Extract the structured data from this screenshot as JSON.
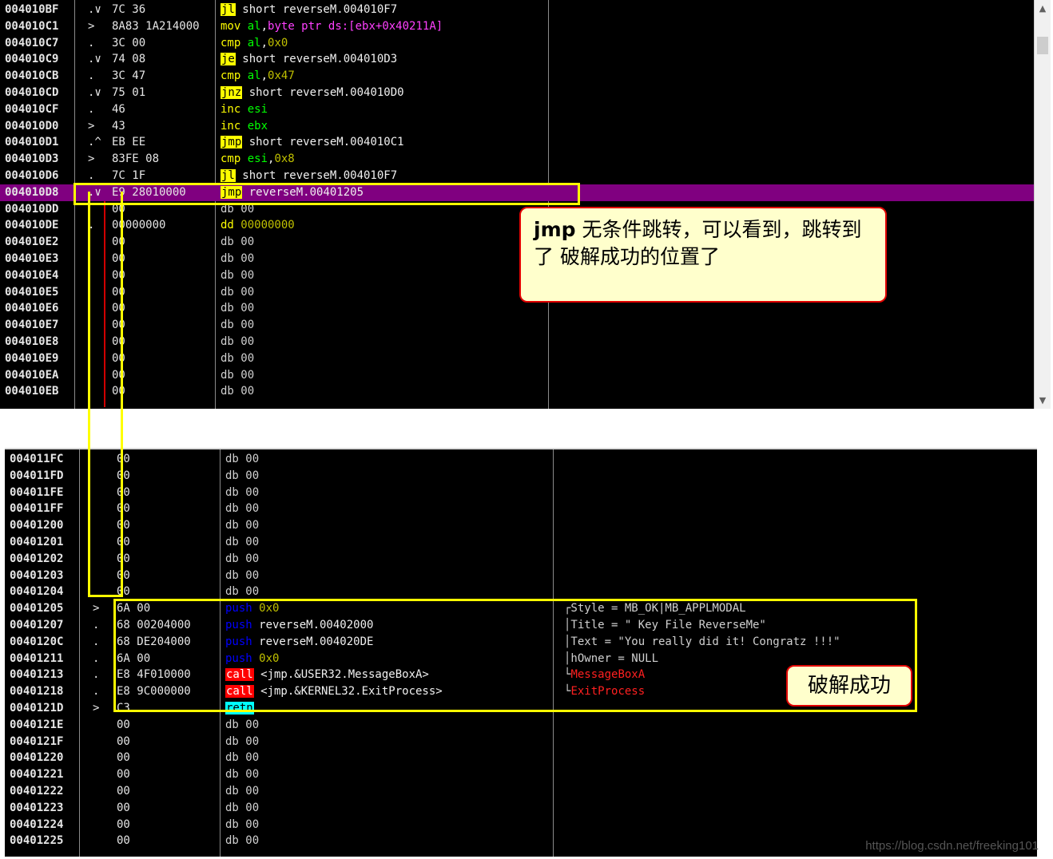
{
  "top_rows": [
    {
      "addr": "004010BF",
      "arrow": ".∨",
      "hex": "7C 36",
      "mn": "jl",
      "mnStyle": "y",
      "args": [
        {
          "t": " short reverseM.004010F7",
          "c": "white"
        }
      ]
    },
    {
      "addr": "004010C1",
      "arrow": ">",
      "hex": "8A83 1A214000",
      "mn": "mov",
      "mnStyle": "g",
      "args": [
        {
          "t": " al",
          "c": "reg"
        },
        {
          "t": ",",
          "c": "white"
        },
        {
          "t": "byte ptr ds:[ebx+0x40211A]",
          "c": "mag"
        }
      ]
    },
    {
      "addr": "004010C7",
      "arrow": ".",
      "hex": "3C 00",
      "mn": "cmp",
      "mnStyle": "g",
      "args": [
        {
          "t": " al",
          "c": "reg"
        },
        {
          "t": ",",
          "c": "white"
        },
        {
          "t": "0x0",
          "c": "num"
        }
      ]
    },
    {
      "addr": "004010C9",
      "arrow": ".∨",
      "hex": "74 08",
      "mn": "je",
      "mnStyle": "y",
      "args": [
        {
          "t": " short reverseM.004010D3",
          "c": "white"
        }
      ]
    },
    {
      "addr": "004010CB",
      "arrow": ".",
      "hex": "3C 47",
      "mn": "cmp",
      "mnStyle": "g",
      "args": [
        {
          "t": " al",
          "c": "reg"
        },
        {
          "t": ",",
          "c": "white"
        },
        {
          "t": "0x47",
          "c": "num"
        }
      ]
    },
    {
      "addr": "004010CD",
      "arrow": ".∨",
      "hex": "75 01",
      "mn": "jnz",
      "mnStyle": "y",
      "args": [
        {
          "t": " short reverseM.004010D0",
          "c": "white"
        }
      ]
    },
    {
      "addr": "004010CF",
      "arrow": ".",
      "hex": "46",
      "mn": "inc",
      "mnStyle": "g",
      "args": [
        {
          "t": " esi",
          "c": "reg"
        }
      ]
    },
    {
      "addr": "004010D0",
      "arrow": ">",
      "hex": "43",
      "mn": "inc",
      "mnStyle": "g",
      "args": [
        {
          "t": " ebx",
          "c": "reg"
        }
      ]
    },
    {
      "addr": "004010D1",
      "arrow": ".^",
      "hex": "EB EE",
      "mn": "jmp",
      "mnStyle": "y",
      "args": [
        {
          "t": " short reverseM.004010C1",
          "c": "white"
        }
      ]
    },
    {
      "addr": "004010D3",
      "arrow": ">",
      "hex": "83FE 08",
      "mn": "cmp",
      "mnStyle": "g",
      "args": [
        {
          "t": " esi",
          "c": "reg"
        },
        {
          "t": ",",
          "c": "white"
        },
        {
          "t": "0x8",
          "c": "num"
        }
      ]
    },
    {
      "addr": "004010D6",
      "arrow": ".",
      "hex": "7C 1F",
      "mn": "jl",
      "mnStyle": "y",
      "args": [
        {
          "t": " short reverseM.004010F7",
          "c": "white"
        }
      ]
    },
    {
      "addr": "004010D8",
      "arrow": ".∨",
      "hex": "E9 28010000",
      "mn": "jmp",
      "mnStyle": "y",
      "args": [
        {
          "t": " reverseM.00401205",
          "c": "white"
        }
      ],
      "highlight": true
    },
    {
      "addr": "004010DD",
      "arrow": "",
      "hex": "00",
      "mn": "db",
      "mnStyle": "d",
      "args": [
        {
          "t": " 00",
          "c": "cm"
        }
      ]
    },
    {
      "addr": "004010DE",
      "arrow": ".",
      "hex": "00000000",
      "mn": "dd",
      "mnStyle": "dd",
      "args": [
        {
          "t": " 00000000",
          "c": "num"
        }
      ]
    },
    {
      "addr": "004010E2",
      "arrow": "",
      "hex": "00",
      "mn": "db",
      "mnStyle": "d",
      "args": [
        {
          "t": " 00",
          "c": "cm"
        }
      ]
    },
    {
      "addr": "004010E3",
      "arrow": "",
      "hex": "00",
      "mn": "db",
      "mnStyle": "d",
      "args": [
        {
          "t": " 00",
          "c": "cm"
        }
      ]
    },
    {
      "addr": "004010E4",
      "arrow": "",
      "hex": "00",
      "mn": "db",
      "mnStyle": "d",
      "args": [
        {
          "t": " 00",
          "c": "cm"
        }
      ]
    },
    {
      "addr": "004010E5",
      "arrow": "",
      "hex": "00",
      "mn": "db",
      "mnStyle": "d",
      "args": [
        {
          "t": " 00",
          "c": "cm"
        }
      ]
    },
    {
      "addr": "004010E6",
      "arrow": "",
      "hex": "00",
      "mn": "db",
      "mnStyle": "d",
      "args": [
        {
          "t": " 00",
          "c": "cm"
        }
      ]
    },
    {
      "addr": "004010E7",
      "arrow": "",
      "hex": "00",
      "mn": "db",
      "mnStyle": "d",
      "args": [
        {
          "t": " 00",
          "c": "cm"
        }
      ]
    },
    {
      "addr": "004010E8",
      "arrow": "",
      "hex": "00",
      "mn": "db",
      "mnStyle": "d",
      "args": [
        {
          "t": " 00",
          "c": "cm"
        }
      ]
    },
    {
      "addr": "004010E9",
      "arrow": "",
      "hex": "00",
      "mn": "db",
      "mnStyle": "d",
      "args": [
        {
          "t": " 00",
          "c": "cm"
        }
      ]
    },
    {
      "addr": "004010EA",
      "arrow": "",
      "hex": "00",
      "mn": "db",
      "mnStyle": "d",
      "args": [
        {
          "t": " 00",
          "c": "cm"
        }
      ]
    },
    {
      "addr": "004010EB",
      "arrow": "",
      "hex": "00",
      "mn": "db",
      "mnStyle": "d",
      "args": [
        {
          "t": " 00",
          "c": "cm"
        }
      ]
    }
  ],
  "bottom_rows": [
    {
      "addr": "004011FC",
      "arrow": "",
      "hex": "00",
      "mn": "db",
      "mnStyle": "d",
      "args": [
        {
          "t": " 00",
          "c": "cm"
        }
      ]
    },
    {
      "addr": "004011FD",
      "arrow": "",
      "hex": "00",
      "mn": "db",
      "mnStyle": "d",
      "args": [
        {
          "t": " 00",
          "c": "cm"
        }
      ]
    },
    {
      "addr": "004011FE",
      "arrow": "",
      "hex": "00",
      "mn": "db",
      "mnStyle": "d",
      "args": [
        {
          "t": " 00",
          "c": "cm"
        }
      ]
    },
    {
      "addr": "004011FF",
      "arrow": "",
      "hex": "00",
      "mn": "db",
      "mnStyle": "d",
      "args": [
        {
          "t": " 00",
          "c": "cm"
        }
      ]
    },
    {
      "addr": "00401200",
      "arrow": "",
      "hex": "00",
      "mn": "db",
      "mnStyle": "d",
      "args": [
        {
          "t": " 00",
          "c": "cm"
        }
      ]
    },
    {
      "addr": "00401201",
      "arrow": "",
      "hex": "00",
      "mn": "db",
      "mnStyle": "d",
      "args": [
        {
          "t": " 00",
          "c": "cm"
        }
      ]
    },
    {
      "addr": "00401202",
      "arrow": "",
      "hex": "00",
      "mn": "db",
      "mnStyle": "d",
      "args": [
        {
          "t": " 00",
          "c": "cm"
        }
      ]
    },
    {
      "addr": "00401203",
      "arrow": "",
      "hex": "00",
      "mn": "db",
      "mnStyle": "d",
      "args": [
        {
          "t": " 00",
          "c": "cm"
        }
      ]
    },
    {
      "addr": "00401204",
      "arrow": "",
      "hex": "00",
      "mn": "db",
      "mnStyle": "d",
      "args": [
        {
          "t": " 00",
          "c": "cm"
        }
      ]
    },
    {
      "addr": "00401205",
      "arrow": ">",
      "hex": "6A 00",
      "mn": "push",
      "mnStyle": "p",
      "args": [
        {
          "t": " 0x0",
          "c": "num"
        }
      ],
      "comment": [
        {
          "t": "┌Style = MB_OK|MB_APPLMODAL",
          "c": "cm"
        }
      ]
    },
    {
      "addr": "00401207",
      "arrow": ".",
      "hex": "68 00204000",
      "mn": "push",
      "mnStyle": "p",
      "args": [
        {
          "t": " reverseM.00402000",
          "c": "white"
        }
      ],
      "comment": [
        {
          "t": "│Title = \" Key File ReverseMe\"",
          "c": "cm"
        }
      ]
    },
    {
      "addr": "0040120C",
      "arrow": ".",
      "hex": "68 DE204000",
      "mn": "push",
      "mnStyle": "p",
      "args": [
        {
          "t": " reverseM.004020DE",
          "c": "white"
        }
      ],
      "comment": [
        {
          "t": "│Text = \"You really did it! Congratz !!!\"",
          "c": "cm"
        }
      ]
    },
    {
      "addr": "00401211",
      "arrow": ".",
      "hex": "6A 00",
      "mn": "push",
      "mnStyle": "p",
      "args": [
        {
          "t": " 0x0",
          "c": "num"
        }
      ],
      "comment": [
        {
          "t": "│hOwner = NULL",
          "c": "cm"
        }
      ]
    },
    {
      "addr": "00401213",
      "arrow": ".",
      "hex": "E8 4F010000",
      "mn": "call",
      "mnStyle": "r",
      "args": [
        {
          "t": " <jmp.&USER32.MessageBoxA>",
          "c": "white"
        }
      ],
      "comment": [
        {
          "t": "└",
          "c": "cm"
        },
        {
          "t": "MessageBoxA",
          "c": "cm-red"
        }
      ]
    },
    {
      "addr": "00401218",
      "arrow": ".",
      "hex": "E8 9C000000",
      "mn": "call",
      "mnStyle": "r",
      "args": [
        {
          "t": " <jmp.&KERNEL32.ExitProcess>",
          "c": "white"
        }
      ],
      "comment": [
        {
          "t": "└",
          "c": "cm"
        },
        {
          "t": "ExitProcess",
          "c": "cm-red"
        }
      ]
    },
    {
      "addr": "0040121D",
      "arrow": ">",
      "hex": "C3",
      "mn": "retn",
      "mnStyle": "c",
      "args": []
    },
    {
      "addr": "0040121E",
      "arrow": "",
      "hex": "00",
      "mn": "db",
      "mnStyle": "d",
      "args": [
        {
          "t": " 00",
          "c": "cm"
        }
      ]
    },
    {
      "addr": "0040121F",
      "arrow": "",
      "hex": "00",
      "mn": "db",
      "mnStyle": "d",
      "args": [
        {
          "t": " 00",
          "c": "cm"
        }
      ]
    },
    {
      "addr": "00401220",
      "arrow": "",
      "hex": "00",
      "mn": "db",
      "mnStyle": "d",
      "args": [
        {
          "t": " 00",
          "c": "cm"
        }
      ]
    },
    {
      "addr": "00401221",
      "arrow": "",
      "hex": "00",
      "mn": "db",
      "mnStyle": "d",
      "args": [
        {
          "t": " 00",
          "c": "cm"
        }
      ]
    },
    {
      "addr": "00401222",
      "arrow": "",
      "hex": "00",
      "mn": "db",
      "mnStyle": "d",
      "args": [
        {
          "t": " 00",
          "c": "cm"
        }
      ]
    },
    {
      "addr": "00401223",
      "arrow": "",
      "hex": "00",
      "mn": "db",
      "mnStyle": "d",
      "args": [
        {
          "t": " 00",
          "c": "cm"
        }
      ]
    },
    {
      "addr": "00401224",
      "arrow": "",
      "hex": "00",
      "mn": "db",
      "mnStyle": "d",
      "args": [
        {
          "t": " 00",
          "c": "cm"
        }
      ]
    },
    {
      "addr": "00401225",
      "arrow": "",
      "hex": "00",
      "mn": "db",
      "mnStyle": "d",
      "args": [
        {
          "t": " 00",
          "c": "cm"
        }
      ]
    }
  ],
  "callout_jmp": {
    "bold": "jmp",
    "text": " 无条件跳转，可以看到，跳转到了 破解成功的位置了"
  },
  "callout_success": {
    "text": "破解成功"
  },
  "watermark": "https://blog.csdn.net/freeking101",
  "icons": {
    "scroll_up": "▲",
    "scroll_down": "▼"
  },
  "colors": {
    "highlight_row": "#800080",
    "annotation_box": "#ffff00",
    "callout_border": "#e00000",
    "callout_bg": "#ffffcc"
  }
}
